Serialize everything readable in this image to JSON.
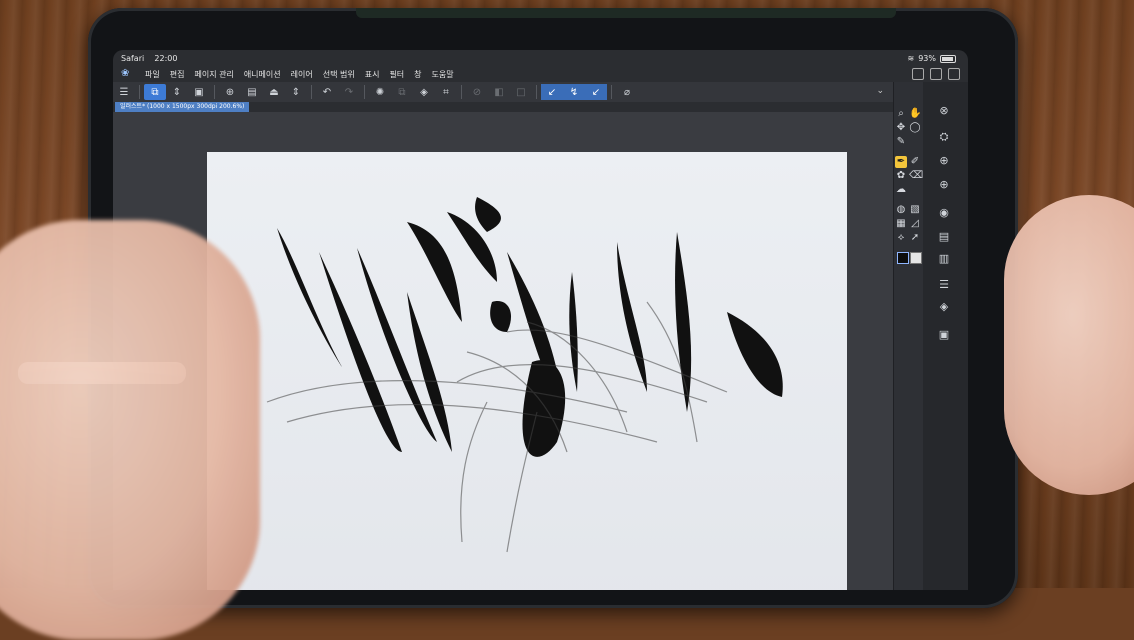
{
  "status_bar": {
    "app": "Safari",
    "time": "22:00",
    "battery": "93%"
  },
  "menu": {
    "items": [
      "파일",
      "편집",
      "페이지 관리",
      "애니메이션",
      "레이어",
      "선택 범위",
      "표시",
      "필터",
      "창",
      "도움말"
    ]
  },
  "toolbar": {
    "icons": [
      "menu-icon",
      "new-canvas-icon",
      "layer-toggle-icon",
      "gallery-icon",
      "new-icon",
      "open-icon",
      "save-icon",
      "undo-icon",
      "redo-icon",
      "loading-icon",
      "copy-icon",
      "fill-icon",
      "crop-icon",
      "clear-icon",
      "mask-icon",
      "frame-icon",
      "pen-a-icon",
      "pen-b-icon",
      "pen-c-icon",
      "reference-icon"
    ]
  },
  "canvas_tab": {
    "title": "일러스트* (1000 x 1500px 300dpi 200.6%)"
  },
  "colors": {
    "accent": "#3d7bd6",
    "active_tool": "#f3c53b",
    "panel_bg": "#2e3035",
    "paper": "#e8ebef"
  }
}
